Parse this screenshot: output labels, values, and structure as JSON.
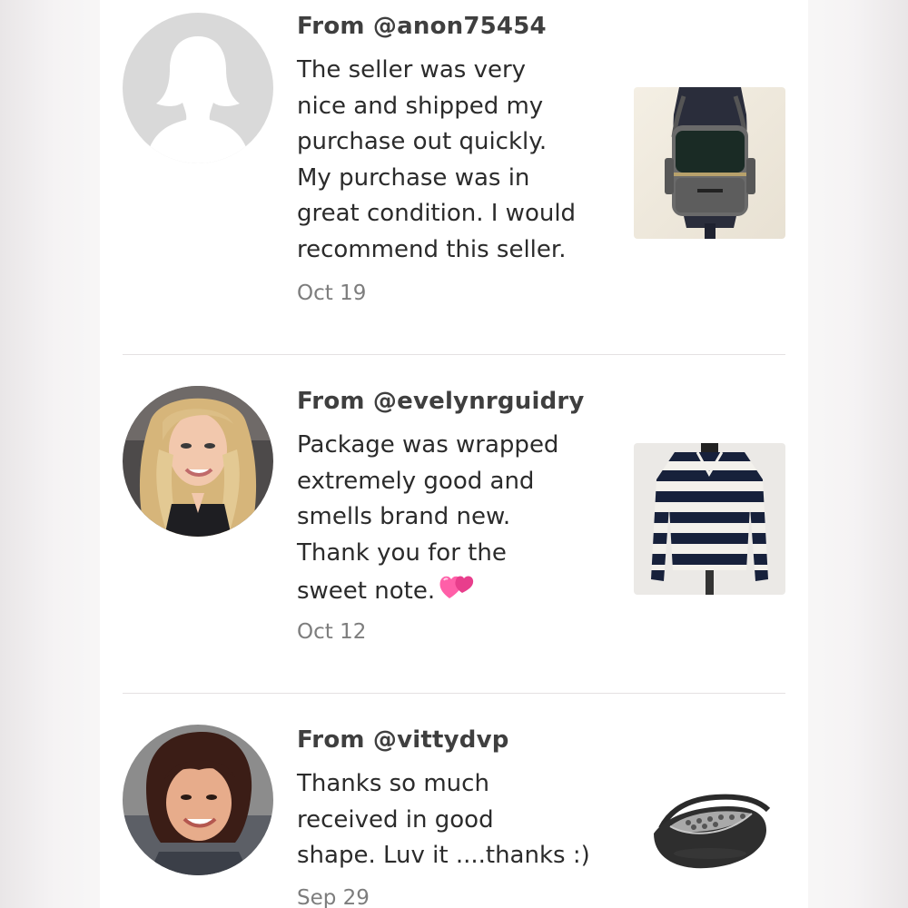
{
  "reviews": [
    {
      "from": "From @anon75454",
      "lines": [
        "The seller was very",
        "nice and shipped my",
        "purchase out quickly.",
        "My purchase was in",
        "great condition. I would",
        "recommend this seller."
      ],
      "date": "Oct 19",
      "avatar": "default-silhouette",
      "product": "gray-backpack-on-dress-form"
    },
    {
      "from": "From @evelynrguidry",
      "lines": [
        "Package was wrapped",
        "extremely good and",
        "smells brand new.",
        "Thank you for the",
        "sweet note."
      ],
      "emoji": "two-hearts-emoji",
      "date": "Oct 12",
      "avatar": "user-photo-blonde",
      "product": "striped-sweater-on-dress-form"
    },
    {
      "from": "From @vittydvp",
      "lines": [
        "Thanks so much",
        "received in good",
        "shape. Luv it ....thanks :)"
      ],
      "date": "Sep 29",
      "avatar": "user-photo-dark-hair",
      "product": "black-belt-bag"
    }
  ],
  "colors": {
    "username": "#3f3f3f",
    "text": "#2b2b2b",
    "date": "#7d7d7d",
    "divider": "#e4e1e2"
  }
}
